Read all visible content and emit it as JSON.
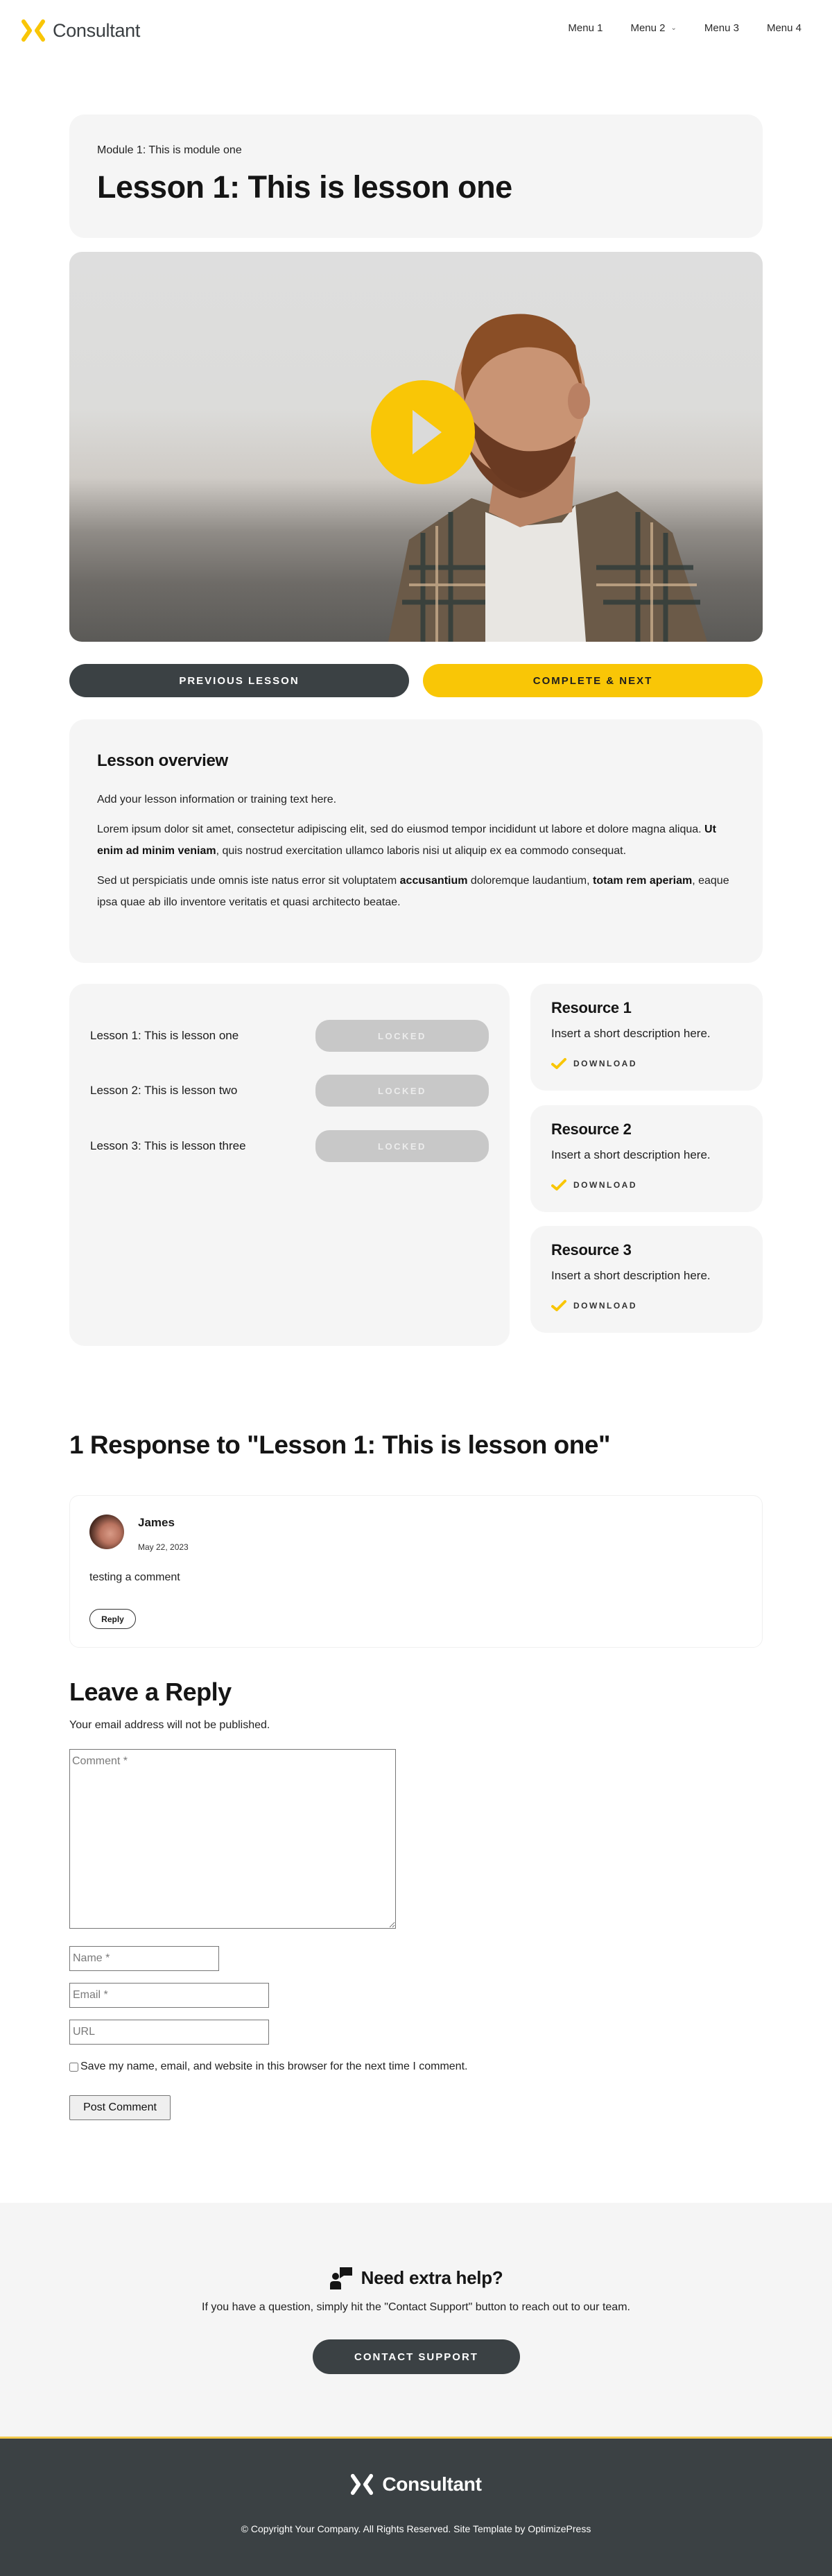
{
  "header": {
    "brand": "Consultant",
    "nav": [
      {
        "label": "Menu 1",
        "has_dropdown": false
      },
      {
        "label": "Menu 2",
        "has_dropdown": true
      },
      {
        "label": "Menu 3",
        "has_dropdown": false
      },
      {
        "label": "Menu 4",
        "has_dropdown": false
      }
    ]
  },
  "colors": {
    "accent": "#f9c606",
    "dark": "#3b4144",
    "card_bg": "#f5f5f5",
    "locked_bg": "#c8c8c8"
  },
  "lesson": {
    "module_label": "Module 1: This is module one",
    "title": "Lesson 1: This is lesson one",
    "video": {
      "play_icon": "play-icon"
    }
  },
  "actions": {
    "previous": "PREVIOUS LESSON",
    "complete_next": "COMPLETE & NEXT"
  },
  "overview": {
    "heading": "Lesson overview",
    "intro": "Add your lesson information or training text here.",
    "p1": {
      "before": "Lorem ipsum dolor sit amet, consectetur adipiscing elit, sed do eiusmod tempor incididunt ut labore et dolore magna aliqua. ",
      "bold": "Ut enim ad minim veniam",
      "after": ", quis nostrud exercitation ullamco laboris nisi ut aliquip ex ea commodo consequat."
    },
    "p2": {
      "before": "Sed ut perspiciatis unde omnis iste natus error sit voluptatem ",
      "bold1": "accusantium",
      "middle": " doloremque laudantium, ",
      "bold2": "totam rem aperiam",
      "after": ", eaque ipsa quae ab illo inventore veritatis et quasi architecto beatae."
    }
  },
  "lesson_list": [
    {
      "title": "Lesson 1: This is lesson one",
      "status": "LOCKED"
    },
    {
      "title": "Lesson 2: This is lesson two",
      "status": "LOCKED"
    },
    {
      "title": "Lesson 3: This is lesson three",
      "status": "LOCKED"
    }
  ],
  "resources": [
    {
      "title": "Resource 1",
      "description": "Insert a short description here.",
      "link": "DOWNLOAD"
    },
    {
      "title": "Resource 2",
      "description": "Insert a short description here.",
      "link": "DOWNLOAD"
    },
    {
      "title": "Resource 3",
      "description": "Insert a short description here.",
      "link": "DOWNLOAD"
    }
  ],
  "comments": {
    "heading": "1 Response to \"Lesson 1: This is lesson one\"",
    "items": [
      {
        "author": "James",
        "date": "May 22, 2023",
        "text": "testing a comment",
        "reply_label": "Reply"
      }
    ]
  },
  "reply_form": {
    "heading": "Leave a Reply",
    "note": "Your email address will not be published.",
    "comment_placeholder": "Comment *",
    "comment_value": "",
    "name_placeholder": "Name *",
    "name_value": "",
    "email_placeholder": "Email *",
    "email_value": "",
    "url_placeholder": "URL",
    "url_value": "",
    "save_label": "Save my name, email, and website in this browser for the next time I comment.",
    "save_checked": false,
    "submit_label": "Post Comment"
  },
  "help": {
    "title": "Need extra help?",
    "text": "If you have a question, simply hit the \"Contact Support\" button to reach out to our team.",
    "button": "CONTACT SUPPORT"
  },
  "footer": {
    "brand": "Consultant",
    "copyright": "© Copyright Your Company.  All Rights Reserved. Site Template by OptimizePress"
  }
}
